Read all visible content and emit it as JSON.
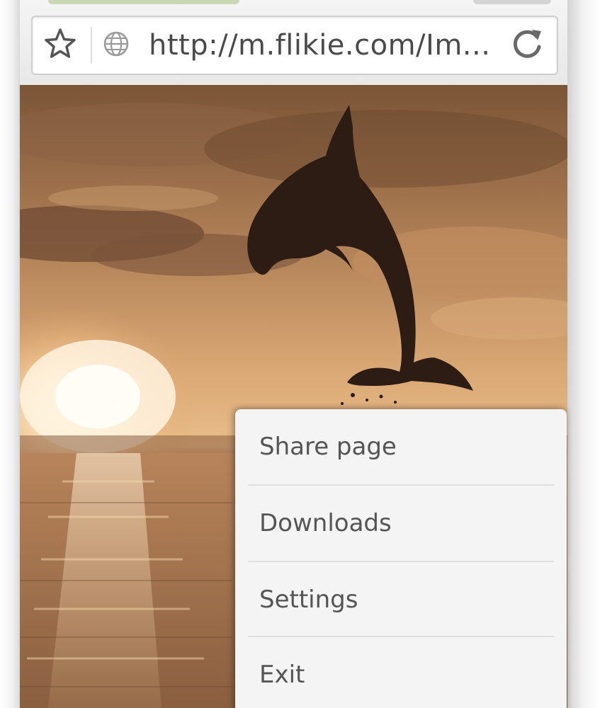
{
  "browser": {
    "url": "http://m.flikie.com/Im...",
    "icons": {
      "bookmark": "star-icon",
      "site": "globe-icon",
      "reload": "reload-icon"
    }
  },
  "menu": {
    "items": [
      {
        "label": "Share page"
      },
      {
        "label": "Downloads"
      },
      {
        "label": "Settings"
      },
      {
        "label": "Exit"
      }
    ]
  },
  "colors": {
    "sky_dark": "#6e4a2e",
    "sky_light": "#e8b785",
    "sun": "#fff6e0",
    "sea": "#b07a4c",
    "dolphin": "#2c1c14",
    "menu_bg": "#f4f4f4",
    "menu_text": "#555555"
  }
}
